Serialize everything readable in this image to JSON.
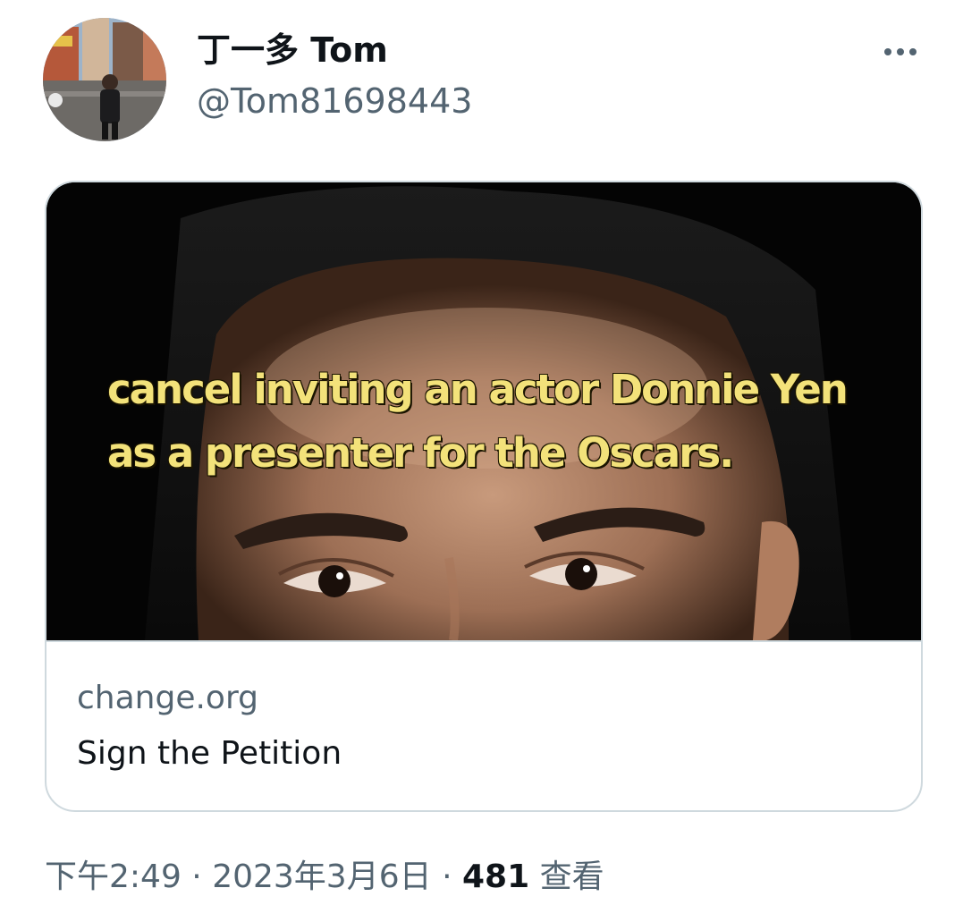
{
  "tweet": {
    "display_name": "丁一多 Tom",
    "handle": "@Tom81698443",
    "more_icon": "more-horizontal-icon"
  },
  "card": {
    "image_caption": "cancel inviting an actor Donnie Yen as a presenter for the Oscars.",
    "domain": "change.org",
    "title": "Sign the Petition"
  },
  "meta": {
    "time": "下午2:49",
    "separator_1": " · ",
    "date": "2023年3月6日",
    "separator_2": " · ",
    "views_count": "481",
    "views_label": "查看"
  }
}
